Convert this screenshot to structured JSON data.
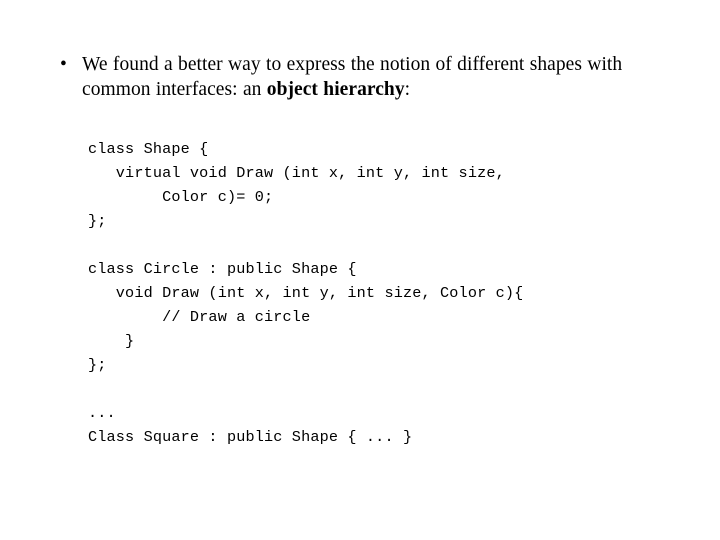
{
  "slide": {
    "background_color": "#ffffff",
    "text_color": "#000000",
    "bullet": {
      "marker": "•",
      "text_before_bold": "We found a better way to express the notion of different shapes with common interfaces:  an ",
      "bold_text": "object hierarchy",
      "text_after_bold": ":"
    },
    "code_blocks": [
      {
        "id": "shape-base-class",
        "text": "class Shape {\n   virtual void Draw (int x, int y, int size,\n        Color c)= 0;\n};"
      },
      {
        "id": "circle-derived-class",
        "text": "class Circle : public Shape {\n   void Draw (int x, int y, int size, Color c){\n        // Draw a circle\n    }\n};"
      },
      {
        "id": "square-derived-class",
        "text": "...\nClass Square : public Shape { ... }"
      }
    ]
  }
}
